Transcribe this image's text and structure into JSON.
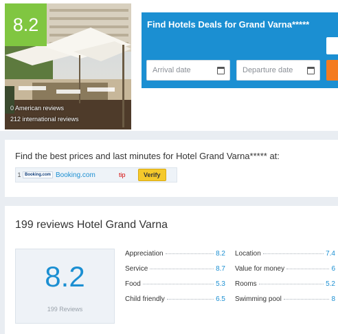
{
  "hotel": {
    "score": "8.2",
    "american_reviews": "0 American reviews",
    "international_reviews": "212 international reviews"
  },
  "deals": {
    "title": "Find Hotels Deals for Grand Varna*****",
    "arrival_placeholder": "Arrival date",
    "departure_placeholder": "Departure date"
  },
  "prices": {
    "title": "Find the best prices and last minutes for Hotel Grand Varna***** at:",
    "row": {
      "index": "1",
      "logo": "Booking.com",
      "link": "Booking.com",
      "tip": "tip",
      "verify": "Verify"
    }
  },
  "reviews": {
    "title": "199 reviews Hotel Grand Varna",
    "score": "8.2",
    "count": "199 Reviews",
    "criteria": [
      {
        "label": "Appreciation",
        "value": "8.2"
      },
      {
        "label": "Location",
        "value": "7.4"
      },
      {
        "label": "Service",
        "value": "8.7"
      },
      {
        "label": "Value for money",
        "value": "6"
      },
      {
        "label": "Food",
        "value": "5.3"
      },
      {
        "label": "Rooms",
        "value": "5.2"
      },
      {
        "label": "Child friendly",
        "value": "6.5"
      },
      {
        "label": "Swimming pool",
        "value": "8"
      }
    ]
  },
  "colors": {
    "score_green": "#80c641",
    "accent_blue": "#1b8fd2",
    "cta_orange": "#f47b20",
    "verify_yellow": "#f5c92b"
  }
}
